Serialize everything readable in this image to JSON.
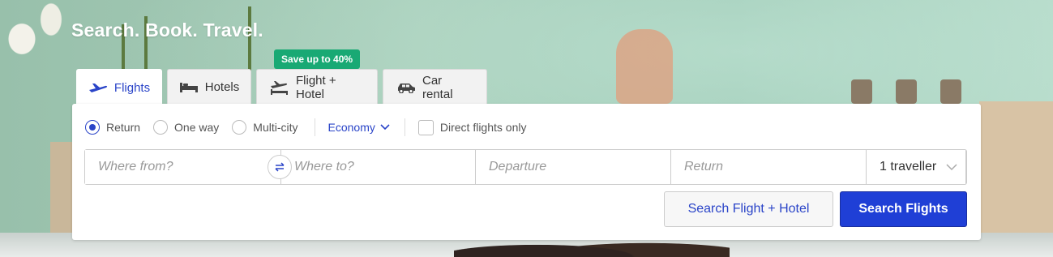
{
  "hero": {
    "title": "Search. Book. Travel."
  },
  "promo": {
    "label": "Save up to 40%"
  },
  "tabs": [
    {
      "label": "Flights",
      "icon": "plane-icon",
      "active": true
    },
    {
      "label": "Hotels",
      "icon": "bed-icon",
      "active": false
    },
    {
      "label": "Flight + Hotel",
      "icon": "plane-bed-icon",
      "active": false
    },
    {
      "label": "Car rental",
      "icon": "car-icon",
      "active": false
    }
  ],
  "trip_type": {
    "options": [
      {
        "label": "Return",
        "selected": true
      },
      {
        "label": "One way",
        "selected": false
      },
      {
        "label": "Multi-city",
        "selected": false
      }
    ]
  },
  "cabin": {
    "value": "Economy"
  },
  "direct_only": {
    "label": "Direct flights only",
    "checked": false
  },
  "fields": {
    "from_placeholder": "Where from?",
    "to_placeholder": "Where to?",
    "departure_placeholder": "Departure",
    "return_placeholder": "Return",
    "travellers": "1 traveller"
  },
  "buttons": {
    "secondary": "Search Flight + Hotel",
    "primary": "Search Flights"
  },
  "colors": {
    "accent": "#2a44c8",
    "primary_button": "#1f3fd6",
    "promo": "#19a974"
  }
}
